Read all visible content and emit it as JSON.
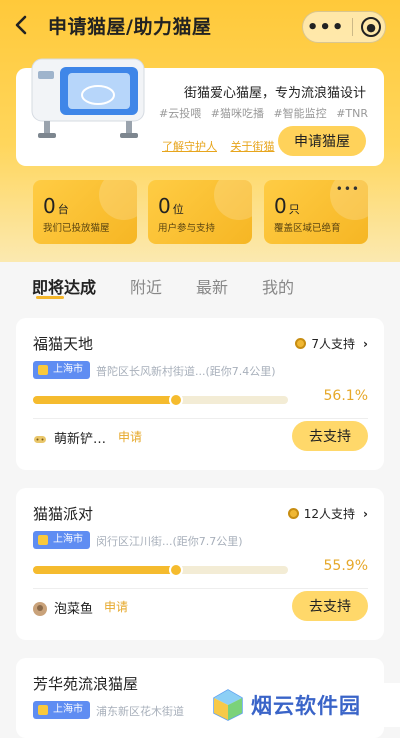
{
  "nav": {
    "title": "申请猫屋/助力猫屋"
  },
  "info": {
    "slogan": "街猫爱心猫屋，专为流浪猫设计",
    "tags": [
      "#云投喂",
      "#猫咪吃播",
      "#智能监控",
      "#TNR"
    ],
    "link_guardian": "了解守护人",
    "link_about": "关于街猫",
    "apply_button": "申请猫屋"
  },
  "stats": [
    {
      "value": "0",
      "unit": "台",
      "label": "我们已投放猫屋"
    },
    {
      "value": "0",
      "unit": "位",
      "label": "用户参与支持"
    },
    {
      "value": "0",
      "unit": "只",
      "label": "覆盖区域已绝育"
    }
  ],
  "tabs": [
    {
      "label": "即将达成",
      "active": true
    },
    {
      "label": "附近",
      "active": false
    },
    {
      "label": "最新",
      "active": false
    },
    {
      "label": "我的",
      "active": false
    }
  ],
  "cards": [
    {
      "name": "福猫天地",
      "support": "7人支持",
      "city": "上海市",
      "address": "普陀区长风新村街道...(距你7.4公里)",
      "progress_percent": 56.1,
      "percent_text": "56.1%",
      "user": "萌新铲…",
      "status": "申请",
      "button": "去支持"
    },
    {
      "name": "猫猫派对",
      "support": "12人支持",
      "city": "上海市",
      "address": "闵行区江川街...(距你7.7公里)",
      "progress_percent": 55.9,
      "percent_text": "55.9%",
      "user": "泡菜鱼",
      "status": "申请",
      "button": "去支持"
    },
    {
      "name": "芳华苑流浪猫屋",
      "city": "上海市",
      "address": "浦东新区花木街道"
    }
  ],
  "watermark": {
    "text": "烟云软件园"
  },
  "colors": {
    "accent": "#f5bb2e",
    "city_badge": "#5f8df2",
    "percent": "#e6a82a"
  }
}
